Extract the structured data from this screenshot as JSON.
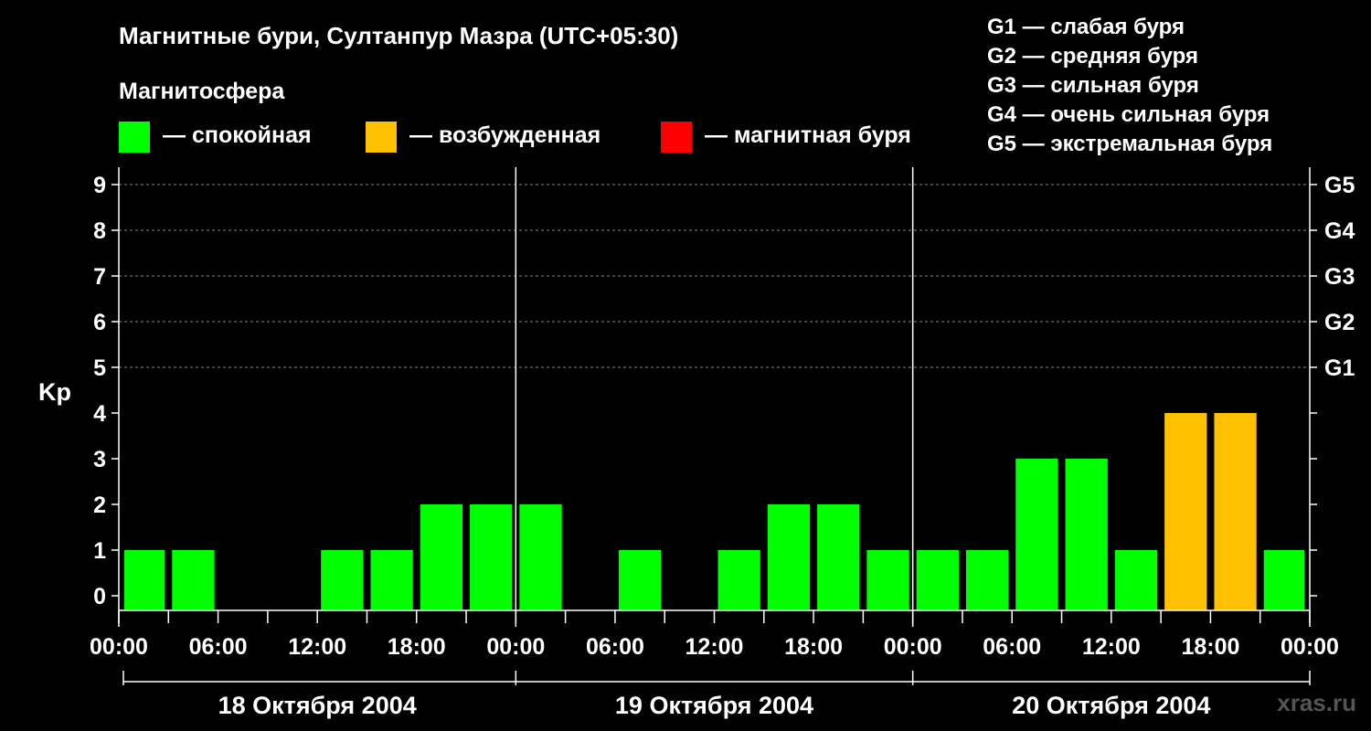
{
  "title": "Магнитные бури, Султанпур Мазра (UTC+05:30)",
  "subtitle": "Магнитосфера",
  "legend": [
    {
      "label": "— спокойная",
      "color": "#00ff00"
    },
    {
      "label": "— возбужденная",
      "color": "#ffc000"
    },
    {
      "label": "— магнитная буря",
      "color": "#ff0000"
    }
  ],
  "g_scale": [
    "G1 — слабая буря",
    "G2 — средняя буря",
    "G3 — сильная буря",
    "G4 — очень сильная буря",
    "G5 — экстремальная буря"
  ],
  "watermark": "xras.ru",
  "chart_data": {
    "type": "bar",
    "ylabel": "Kp",
    "ylim": [
      0,
      9
    ],
    "y_ticks": [
      "0",
      "1",
      "2",
      "3",
      "4",
      "5",
      "6",
      "7",
      "8",
      "9"
    ],
    "right_ticks": [
      {
        "value": 5,
        "label": "G1"
      },
      {
        "value": 6,
        "label": "G2"
      },
      {
        "value": 7,
        "label": "G3"
      },
      {
        "value": 8,
        "label": "G4"
      },
      {
        "value": 9,
        "label": "G5"
      }
    ],
    "x_tick_labels": [
      "00:00",
      "06:00",
      "12:00",
      "18:00",
      "00:00",
      "06:00",
      "12:00",
      "18:00",
      "00:00",
      "06:00",
      "12:00",
      "18:00",
      "00:00"
    ],
    "days": [
      "18 Октября 2004",
      "19 Октября 2004",
      "20 Октября 2004"
    ],
    "interval_hours": 3,
    "timezone": "UTC+05:30",
    "grid": "dashed at 5–9",
    "values": [
      1,
      1,
      0,
      0,
      1,
      1,
      2,
      2,
      2,
      0,
      1,
      0,
      1,
      2,
      2,
      1,
      1,
      1,
      3,
      3,
      1,
      4,
      4,
      1
    ],
    "colors": [
      "#00ff00",
      "#00ff00",
      "#00ff00",
      "#00ff00",
      "#00ff00",
      "#00ff00",
      "#00ff00",
      "#00ff00",
      "#00ff00",
      "#00ff00",
      "#00ff00",
      "#00ff00",
      "#00ff00",
      "#00ff00",
      "#00ff00",
      "#00ff00",
      "#00ff00",
      "#00ff00",
      "#00ff00",
      "#00ff00",
      "#00ff00",
      "#ffc000",
      "#ffc000",
      "#00ff00"
    ]
  }
}
